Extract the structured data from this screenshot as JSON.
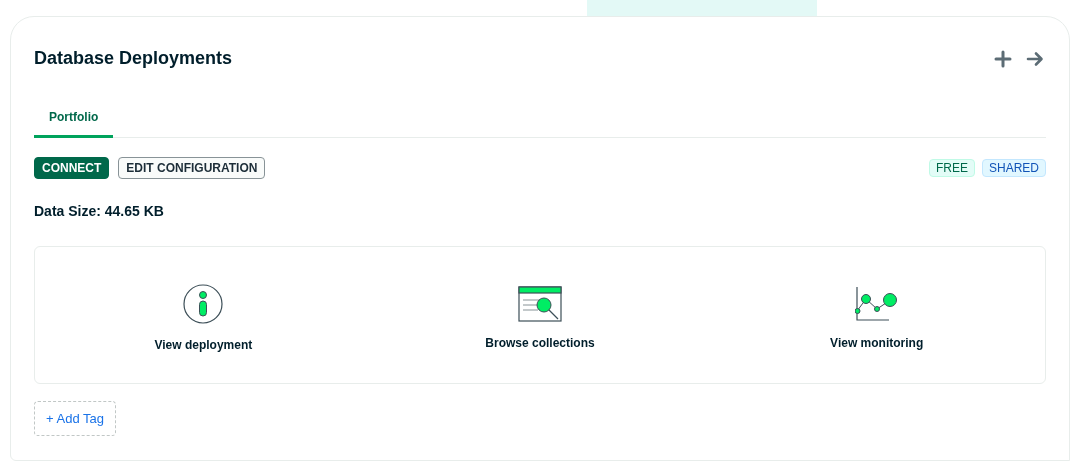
{
  "title": "Database Deployments",
  "tabs": [
    {
      "label": "Portfolio",
      "selected": true
    }
  ],
  "buttons": [
    {
      "label": "CONNECT",
      "kind": "primary"
    },
    {
      "label": "EDIT CONFIGURATION",
      "kind": "secondary"
    }
  ],
  "badges": [
    {
      "label": "FREE",
      "color": "#00684a"
    },
    {
      "label": "SHARED",
      "color": "#1254b7"
    }
  ],
  "data_size": "Data Size: 44.65 KB",
  "actions": [
    {
      "label": "View deployment",
      "kind": "info"
    },
    {
      "label": "Browse collections",
      "kind": "browse"
    },
    {
      "label": "View monitoring",
      "kind": "chart"
    }
  ],
  "add_tag": "+ Add Tag"
}
